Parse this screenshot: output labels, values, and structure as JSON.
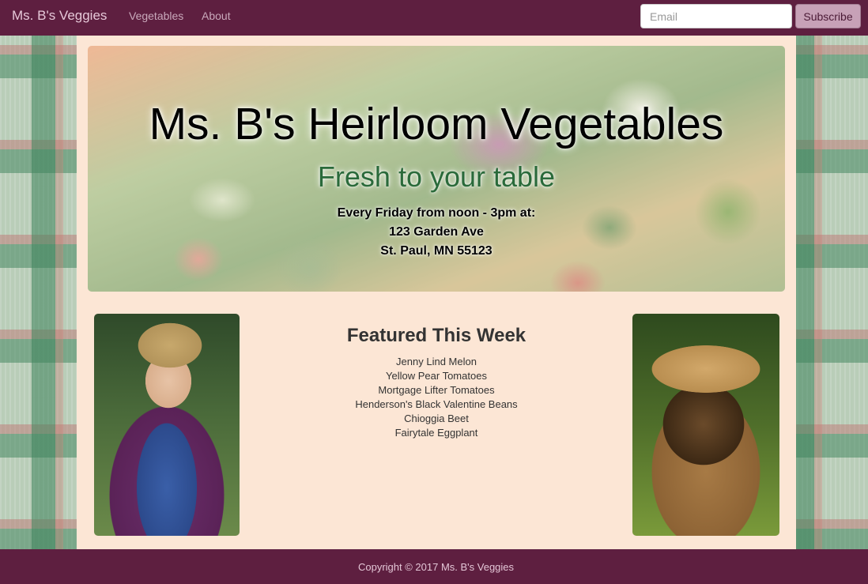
{
  "navbar": {
    "brand": "Ms. B's Veggies",
    "links": [
      "Vegetables",
      "About"
    ],
    "email_placeholder": "Email",
    "subscribe_label": "Subscribe"
  },
  "hero": {
    "title": "Ms. B's Heirloom Vegetables",
    "subtitle": "Fresh to your table",
    "schedule": "Every Friday from noon - 3pm at:",
    "address_line1": "123 Garden Ave",
    "address_line2": "St. Paul, MN 55123"
  },
  "featured": {
    "heading": "Featured This Week",
    "items": [
      "Jenny Lind Melon",
      "Yellow Pear Tomatoes",
      "Mortgage Lifter Tomatoes",
      "Henderson's Black Valentine Beans",
      "Chioggia Beet",
      "Fairytale Eggplant"
    ]
  },
  "footer": {
    "copyright": "Copyright © 2017 Ms. B's Veggies"
  },
  "colors": {
    "navbar_bg": "#5e1f40",
    "content_bg": "#fce6d5",
    "subtitle_green": "#2a6a3a",
    "subscribe_bg": "#c7a1b7"
  }
}
